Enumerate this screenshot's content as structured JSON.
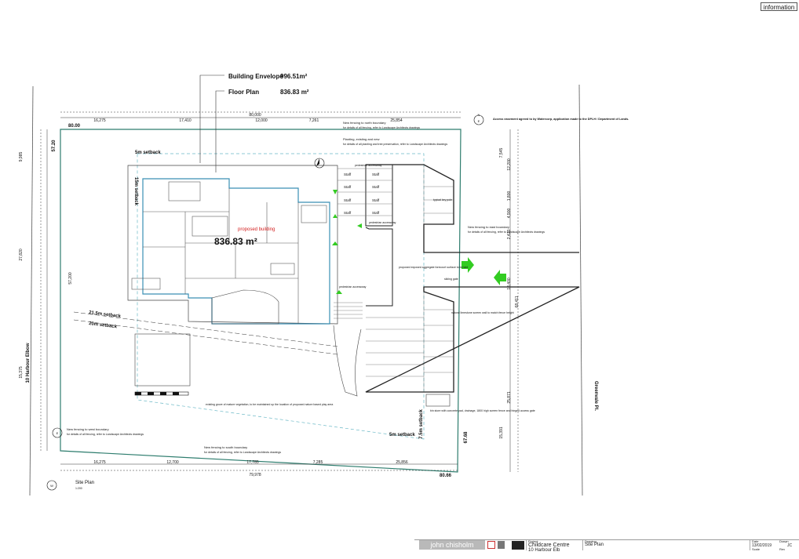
{
  "header": {
    "info_label": "information"
  },
  "areas": {
    "envelope_label": "Building Envelope",
    "envelope_value": "996.51m²",
    "floor_label": "Floor Plan",
    "floor_value": "836.83 m²",
    "big_area": "836.83 m²",
    "proposed_building": "proposed building"
  },
  "dimensions": {
    "top_overall": "80,000",
    "top_segments": [
      "16,275",
      "17,410",
      "12,000",
      "7,261",
      "25,854"
    ],
    "bottom_overall": "79,978",
    "bottom_segments": [
      "16,275",
      "12,700",
      "17,785",
      "7,285",
      "25,856"
    ],
    "left_overall": "57,200",
    "left_segments": [
      "9,985",
      "27,820",
      "15,375"
    ],
    "right_segments_top": [
      "7,545",
      "12,200",
      "1,800",
      "4,900",
      "2,420",
      "18,400"
    ],
    "right_overall": "68,411",
    "right_segments_bottom": [
      "25,871",
      "15,391"
    ]
  },
  "boundary_marks": {
    "top_left_length": "80.00",
    "left_top": "57.20",
    "right_bottom": "67.68",
    "bottom_right": "80.66"
  },
  "streets": {
    "left": "10 Harbour Elbow",
    "right": "Greenvale Pl."
  },
  "setbacks": {
    "top": "5m setback",
    "left": "15m setback",
    "diag1": "21.5m setback",
    "diag2": "20m setback",
    "bottom": "5m setback",
    "right": "7.5m setback"
  },
  "notes": {
    "north_title": "New fencing to north boundary",
    "north_body": "for details of all fencing, refer to Landscape Architects drawings",
    "planting_title": "Planting, existing and new",
    "planting_body": "for details of all planting and tree preservation, refer to Landscape Architects drawings",
    "easement": "Access easement agreed to by Watercorp, application made to the DPLH / Department of Lands.",
    "east_title": "New fencing to east boundary",
    "east_body": "for details of all fencing, refer to Landscape Architects drawings",
    "west_title": "New fencing to west boundary",
    "west_body": "for details of all fencing, refer to Landscape Architects drawings",
    "south_title": "New fencing to south boundary",
    "south_body": "for details of all fencing, refer to Landscape Architects drawings",
    "vegetation": "existing grove of mature vegetation, to be maintained up the location of proposed nature based play area",
    "bin_store": "bin store with concrete pad, drainage, 1800 high screen fence and hinged access gate",
    "limestone": "natural limestone screen wall to match fence height",
    "forecourt": "proposed exposed aggregate forecourt surface to be laid",
    "pedestrian1": "pedestrian accessway",
    "pedestrian2": "pedestrian accessway",
    "pedestrian3": "pedestrian accessway",
    "sliding_gate": "sliding gate",
    "key_pole": "typical key pole"
  },
  "parking": {
    "staff_labels": [
      "Staff",
      "Staff",
      "Staff",
      "Staff",
      "Staff",
      "Staff",
      "Staff",
      "Staff"
    ]
  },
  "drawing": {
    "view_name": "Site Plan",
    "view_scale": "1:200",
    "north_letter": "N",
    "east_letter": "E",
    "west_letter": "W"
  },
  "title_block": {
    "firm": "john chisholm design",
    "project_label": "Project",
    "project_name": "Childcare Centre",
    "address": "10 Harbour Elb",
    "sheet_label": "Drawing",
    "sheet_title": "Site Plan",
    "date_label": "Date",
    "date": "13/02/2019",
    "drawn_label": "Drawn",
    "drawn": "JC",
    "scale_label": "Scale",
    "rev_label": "Rev"
  },
  "colors": {
    "ink": "#1a1a1a",
    "boundary": "#2e7d6e",
    "building": "#3a8fb5",
    "interior": "#5a5a5a",
    "arrow": "#33cc22",
    "label_red": "#d32020",
    "dash": "#6ab8c6"
  }
}
